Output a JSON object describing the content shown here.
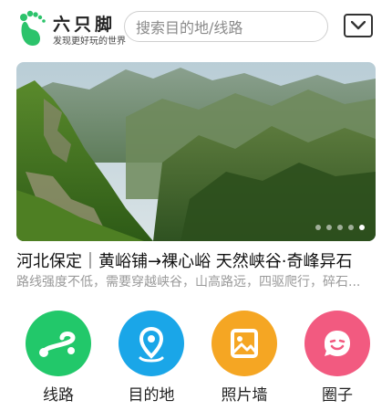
{
  "header": {
    "brand_title": "六只脚",
    "brand_subtitle": "发现更好玩的世界",
    "search_placeholder": "搜索目的地/线路",
    "menu_icon": "chevron-down-icon"
  },
  "banner": {
    "image_description": "mountain-valley-photo",
    "slide_count": 5,
    "active_slide": 5
  },
  "article": {
    "title": "河北保定｜黄峪铺→裸心峪 天然峡谷·奇峰异石",
    "summary": "路线强度不低，需要穿越峡谷，山高路远，四驱爬行，碎石..."
  },
  "nav": [
    {
      "label": "线路",
      "icon": "route-icon",
      "color": "#22c86a"
    },
    {
      "label": "目的地",
      "icon": "location-pin-icon",
      "color": "#1aa6e8"
    },
    {
      "label": "照片墙",
      "icon": "photo-icon",
      "color": "#f5a623"
    },
    {
      "label": "圈子",
      "icon": "chat-smile-icon",
      "color": "#f25a80"
    }
  ],
  "colors": {
    "brand": "#2cc36b"
  }
}
